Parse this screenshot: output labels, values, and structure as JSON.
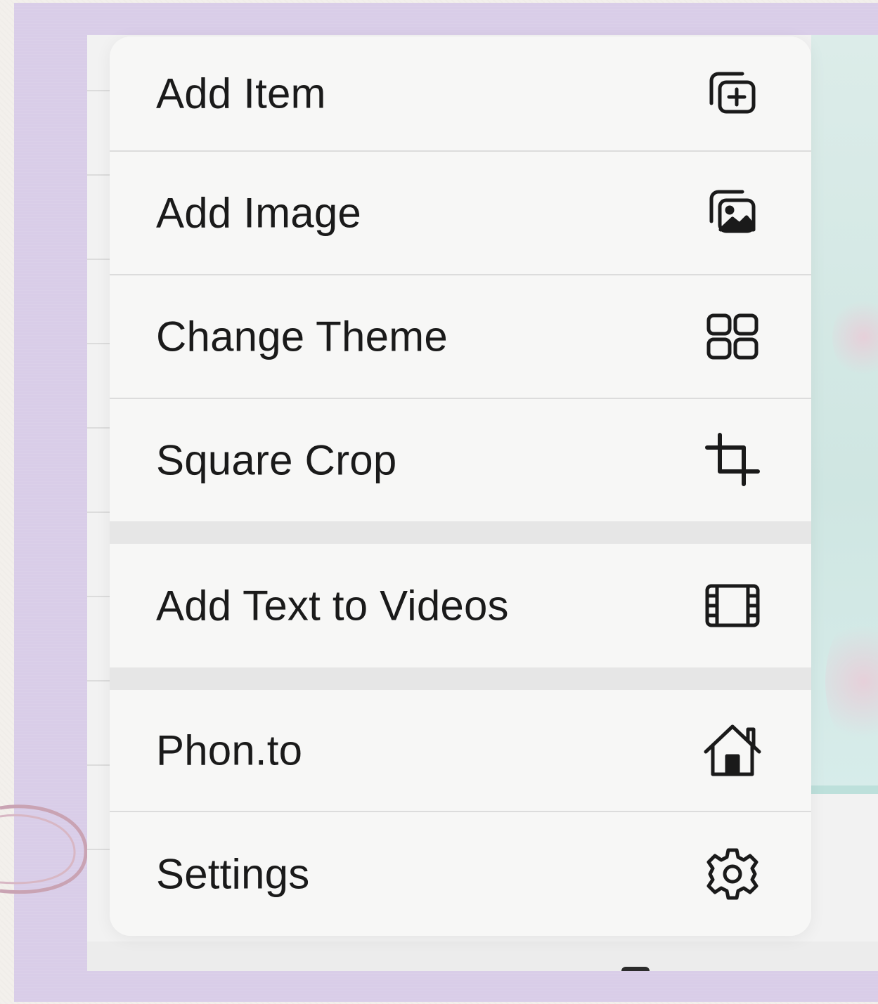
{
  "menu": {
    "items": [
      {
        "label": "Add Item",
        "icon": "add-item-icon"
      },
      {
        "label": "Add Image",
        "icon": "photo-stack-icon"
      },
      {
        "label": "Change Theme",
        "icon": "grid-icon"
      },
      {
        "label": "Square Crop",
        "icon": "crop-icon"
      },
      {
        "label": "Add Text to Videos",
        "icon": "film-icon"
      },
      {
        "label": "Phon.to",
        "icon": "house-icon"
      },
      {
        "label": "Settings",
        "icon": "gear-icon"
      }
    ]
  },
  "colors": {
    "background_card": "#d9cde8",
    "menu_background": "#f7f7f6",
    "text": "#1a1a1a",
    "section_gap": "#e6e6e6"
  }
}
